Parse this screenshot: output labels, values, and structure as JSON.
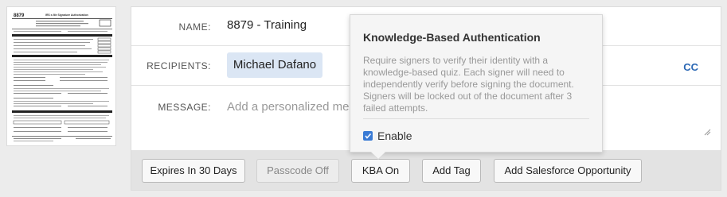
{
  "document_thumbnail": {
    "form_number": "8879",
    "form_title": "IRS e-file Signature Authorization"
  },
  "form": {
    "name_label": "NAME:",
    "name_value": "8879 - Training",
    "recipients_label": "RECIPIENTS:",
    "recipients": [
      "Michael Dafano"
    ],
    "cc_label": "CC",
    "message_label": "MESSAGE:",
    "message_placeholder": "Add a personalized message",
    "message_value": ""
  },
  "toolbar": {
    "expires_label": "Expires In 30 Days",
    "passcode_label": "Passcode Off",
    "kba_label": "KBA On",
    "add_tag_label": "Add Tag",
    "salesforce_label": "Add Salesforce Opportunity"
  },
  "kba_popover": {
    "title": "Knowledge-Based Authentication",
    "description": "Require signers to verify their identity with a knowledge-based quiz. Each signer will need to independently verify before signing the document. Signers will be locked out of the document after 3 failed attempts.",
    "enable_label": "Enable",
    "enabled": true
  },
  "colors": {
    "accent": "#2a67b4",
    "chip_bg": "#dbe6f4",
    "checkbox": "#3a7bd5"
  }
}
